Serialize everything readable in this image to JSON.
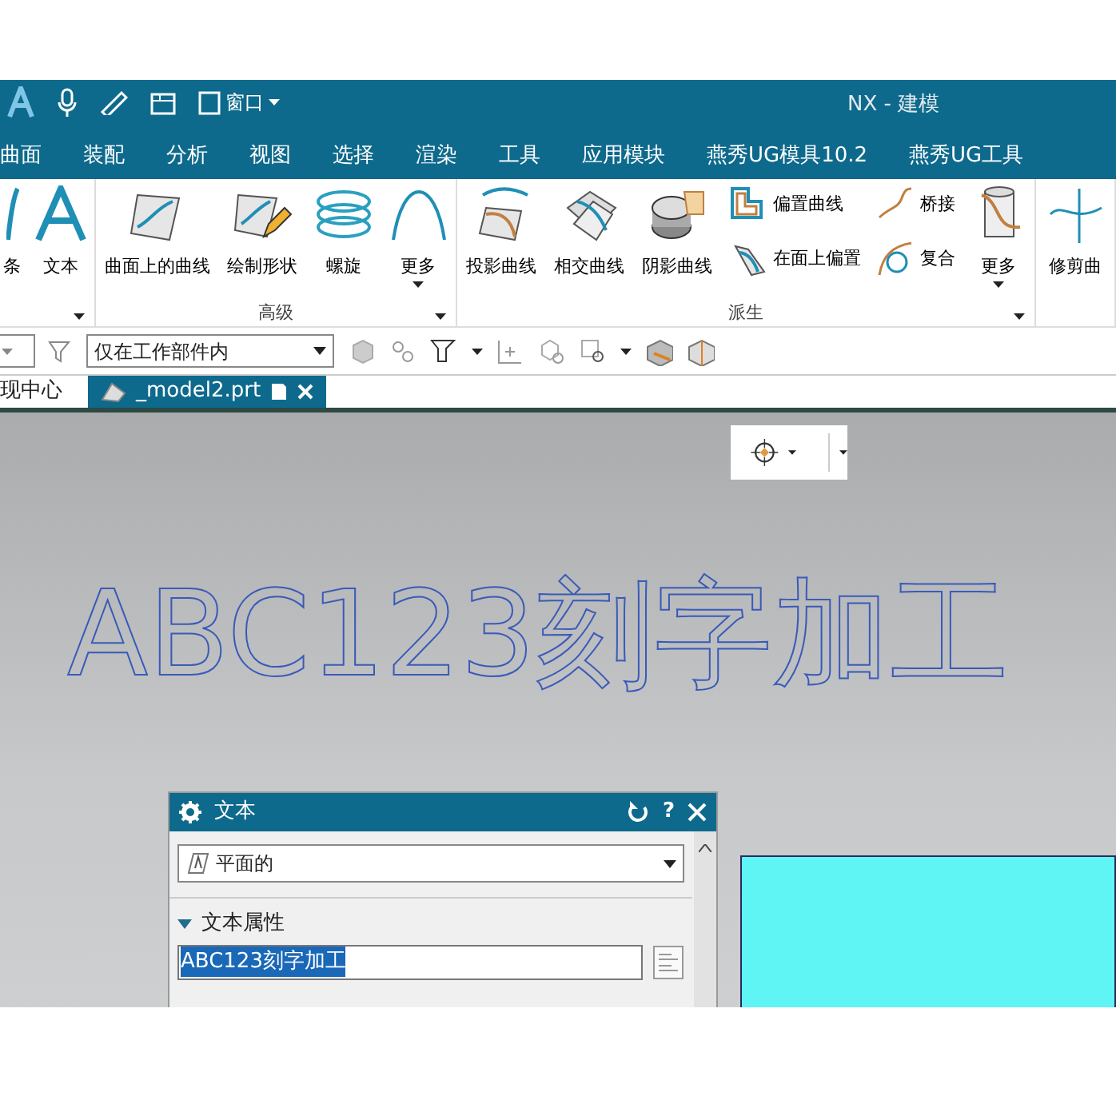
{
  "quick_access": {
    "window_menu": "窗口"
  },
  "window": {
    "title": "NX - 建模"
  },
  "menu": [
    "曲面",
    "装配",
    "分析",
    "视图",
    "选择",
    "渲染",
    "工具",
    "应用模块",
    "燕秀UG模具10.2",
    "燕秀UG工具"
  ],
  "ribbon": {
    "groups": [
      {
        "buttons": [
          {
            "kind": "large",
            "label": "条"
          },
          {
            "kind": "large",
            "label": "文本"
          }
        ],
        "has_launcher": true
      },
      {
        "label": "高级",
        "buttons": [
          {
            "kind": "large",
            "label": "曲面上的曲线"
          },
          {
            "kind": "large",
            "label": "绘制形状"
          },
          {
            "kind": "large",
            "label": "螺旋"
          },
          {
            "kind": "menu",
            "label": "更多"
          }
        ],
        "has_launcher": true
      },
      {
        "label": "派生",
        "buttons": [
          {
            "kind": "large",
            "label": "投影曲线"
          },
          {
            "kind": "large",
            "label": "相交曲线"
          },
          {
            "kind": "large",
            "label": "阴影曲线"
          },
          {
            "kind": "small",
            "label": "偏置曲线"
          },
          {
            "kind": "small",
            "label": "在面上偏置"
          },
          {
            "kind": "small",
            "label": "桥接"
          },
          {
            "kind": "small",
            "label": "复合"
          },
          {
            "kind": "menu",
            "label": "更多"
          }
        ],
        "has_launcher": true
      },
      {
        "buttons": [
          {
            "kind": "large",
            "label": "修剪曲"
          }
        ],
        "has_launcher": false
      }
    ]
  },
  "toolbar": {
    "scope_filter": "仅在工作部件内"
  },
  "tabs": [
    {
      "label": "现中心",
      "selected": false
    },
    {
      "label": "_model2.prt",
      "selected": true
    }
  ],
  "viewport": {
    "model_text": "ABC123刻字加工"
  },
  "dialog": {
    "title": "文本",
    "help": "?",
    "type": "平面的",
    "section": {
      "title": "文本属性",
      "expanded": true
    },
    "text_value": "ABC123刻字加工",
    "text_selected": true
  }
}
